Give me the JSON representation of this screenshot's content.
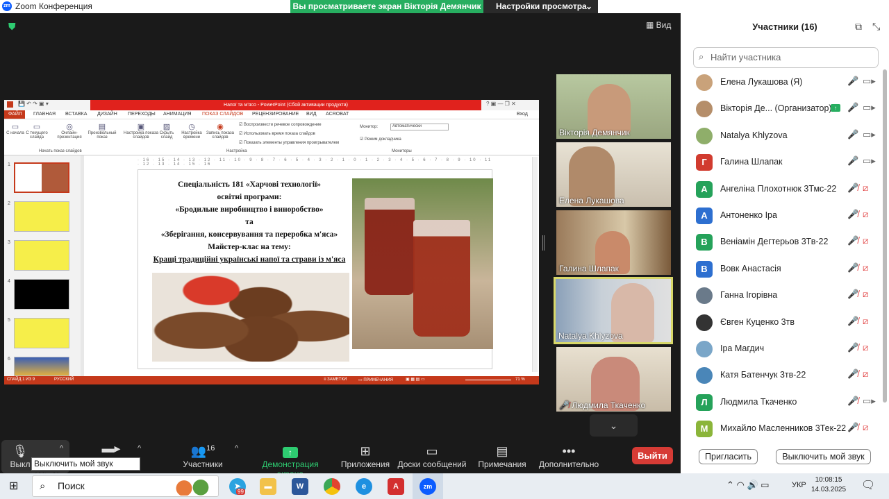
{
  "window": {
    "title": "Zoom Конференция"
  },
  "share_banner": {
    "text": "Вы просматриваете экран Вікторія Демянчик",
    "view_options": "Настройки просмотра"
  },
  "view_button": "Вид",
  "ppt": {
    "title": "Напої та м'ясо - PowerPoint (Сбой активации продукта)",
    "tabs": [
      "ФАЙЛ",
      "ГЛАВНАЯ",
      "ВСТАВКА",
      "ДИЗАЙН",
      "ПЕРЕХОДЫ",
      "АНИМАЦИЯ",
      "ПОКАЗ СЛАЙДОВ",
      "РЕЦЕНЗИРОВАНИЕ",
      "ВИД",
      "ACROBAT"
    ],
    "user": "Вход",
    "ribbon": {
      "b1": "С начала",
      "b2": "С текущего слайда",
      "b3": "Онлайн-презентация",
      "b4": "Произвольный показ",
      "group1": "Начать показ слайдов",
      "b5": "Настройка показа слайдов",
      "b6": "Скрыть слайд",
      "b7": "Настройка времени",
      "b8": "Запись показа слайдов",
      "c1": "Воспроизвести речевое сопровождение",
      "c2": "Использовать время показа слайдов",
      "c3": "Показать элементы управления проигрывателем",
      "group2": "Настройка",
      "monitor_label": "Монитор:",
      "monitor_value": "Автоматически",
      "presenter": "Режим докладчика",
      "group3": "Мониторы"
    },
    "thumb_nums": [
      "1",
      "2",
      "3",
      "4",
      "5",
      "6"
    ],
    "slide": {
      "line1": "Спеціальність 181 «Харчові технології»",
      "line2": "освітні програми:",
      "line3": "«Бродильне виробництво і виноробство»",
      "line4": "та",
      "line5": "«Зберігання, консервування та переробка м'яса»",
      "line6": "Майстер-клас на тему:",
      "line7": "Кращі традиційні українські напої та страви із м'яса"
    },
    "status": {
      "slide": "СЛАЙД 1 ИЗ 9",
      "lang": "РУССКИЙ",
      "notes": "ЗАМЕТКИ",
      "comments": "ПРИМЕЧАНИЯ",
      "zoom": "71 %"
    }
  },
  "gallery": [
    {
      "name": "Вікторія Демянчик"
    },
    {
      "name": "Елена Лукашова"
    },
    {
      "name": "Галина Шлапак"
    },
    {
      "name": "Natalya Khlyzova"
    },
    {
      "name": "Людмила Ткаченко"
    }
  ],
  "toolbar": {
    "mute": "Выкл",
    "mute_tooltip": "Выключить мой звук (Alt+A)",
    "participants": "Участники",
    "participants_count": "16",
    "share": "Демонстрация экрана",
    "apps": "Приложения",
    "whiteboards": "Доски сообщений",
    "notes": "Примечания",
    "more": "Дополнительно",
    "leave": "Выйти"
  },
  "panel": {
    "title": "Участники (16)",
    "search_placeholder": "Найти участника",
    "participants": [
      {
        "name": "Елена Лукашова (Я)",
        "initial": "",
        "color": "#c9a27a",
        "mic": "on",
        "cam": "on"
      },
      {
        "name": "Вікторія Де... (Организатор)",
        "initial": "",
        "color": "#b58e6a",
        "mic": "on",
        "cam": "on"
      },
      {
        "name": "Natalya Khlyzova",
        "initial": "",
        "color": "#8fae6a",
        "mic": "active",
        "cam": "on"
      },
      {
        "name": "Галина Шлапак",
        "initial": "Г",
        "color": "#d13b2f",
        "mic": "on",
        "cam": "on"
      },
      {
        "name": "Ангеліна Плохотнюк 3Тмс-22",
        "initial": "А",
        "color": "#25a25a",
        "mic": "off",
        "cam": "off"
      },
      {
        "name": "Антоненко Іра",
        "initial": "А",
        "color": "#2d6fd0",
        "mic": "off",
        "cam": "off"
      },
      {
        "name": "Веніамін Дегтерьов 3Тв-22",
        "initial": "В",
        "color": "#25a25a",
        "mic": "off",
        "cam": "off"
      },
      {
        "name": "Вовк Анастасія",
        "initial": "В",
        "color": "#2d6fd0",
        "mic": "off",
        "cam": "off"
      },
      {
        "name": "Ганна Ігорівна",
        "initial": "",
        "color": "#6a7a8a",
        "mic": "off",
        "cam": "off"
      },
      {
        "name": "Євген Куценко 3тв",
        "initial": "",
        "color": "#333333",
        "mic": "off",
        "cam": "off"
      },
      {
        "name": "Іра Магдич",
        "initial": "",
        "color": "#7aa6c8",
        "mic": "off",
        "cam": "off"
      },
      {
        "name": "Катя Батенчук 3тв-22",
        "initial": "",
        "color": "#4a86b8",
        "mic": "off",
        "cam": "off"
      },
      {
        "name": "Людмила Ткаченко",
        "initial": "Л",
        "color": "#25a25a",
        "mic": "off",
        "cam": "on"
      },
      {
        "name": "Михайло Масленников 3Тек-22",
        "initial": "М",
        "color": "#8bb53a",
        "mic": "off",
        "cam": "off"
      }
    ],
    "invite": "Пригласить",
    "mute_me": "Выключить мой звук"
  },
  "taskbar": {
    "search": "Поиск",
    "lang": "УКР",
    "time": "10:08:15",
    "date": "14.03.2025",
    "badge": "99"
  }
}
